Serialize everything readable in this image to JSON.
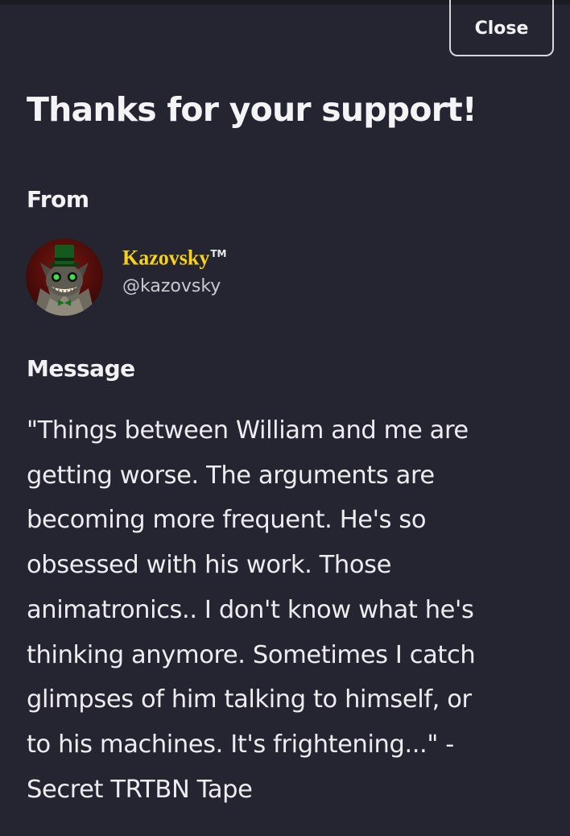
{
  "dialog": {
    "close_label": "Close",
    "title": "Thanks for your support!"
  },
  "from": {
    "label": "From",
    "display_name": "Kazovsky",
    "trademark": "TM",
    "handle": "@kazovsky",
    "avatar_icon": "avatar-cat-top-hat-icon"
  },
  "message": {
    "label": "Message",
    "lines": [
      "\"Things between William and me are",
      "getting worse. The arguments are",
      "becoming more frequent. He's so",
      "obsessed with his work. Those",
      "animatronics.. I don't know what he's",
      "thinking anymore. Sometimes I catch",
      "glimpses of him talking to himself, or",
      "to his machines. It's frightening...\" -",
      "Secret TRTBN Tape"
    ]
  },
  "colors": {
    "background": "#242530",
    "text": "#f2f2f5",
    "name_accent": "#f7d21a",
    "handle": "#c9c9cf",
    "close_border": "#d6d6dc"
  }
}
